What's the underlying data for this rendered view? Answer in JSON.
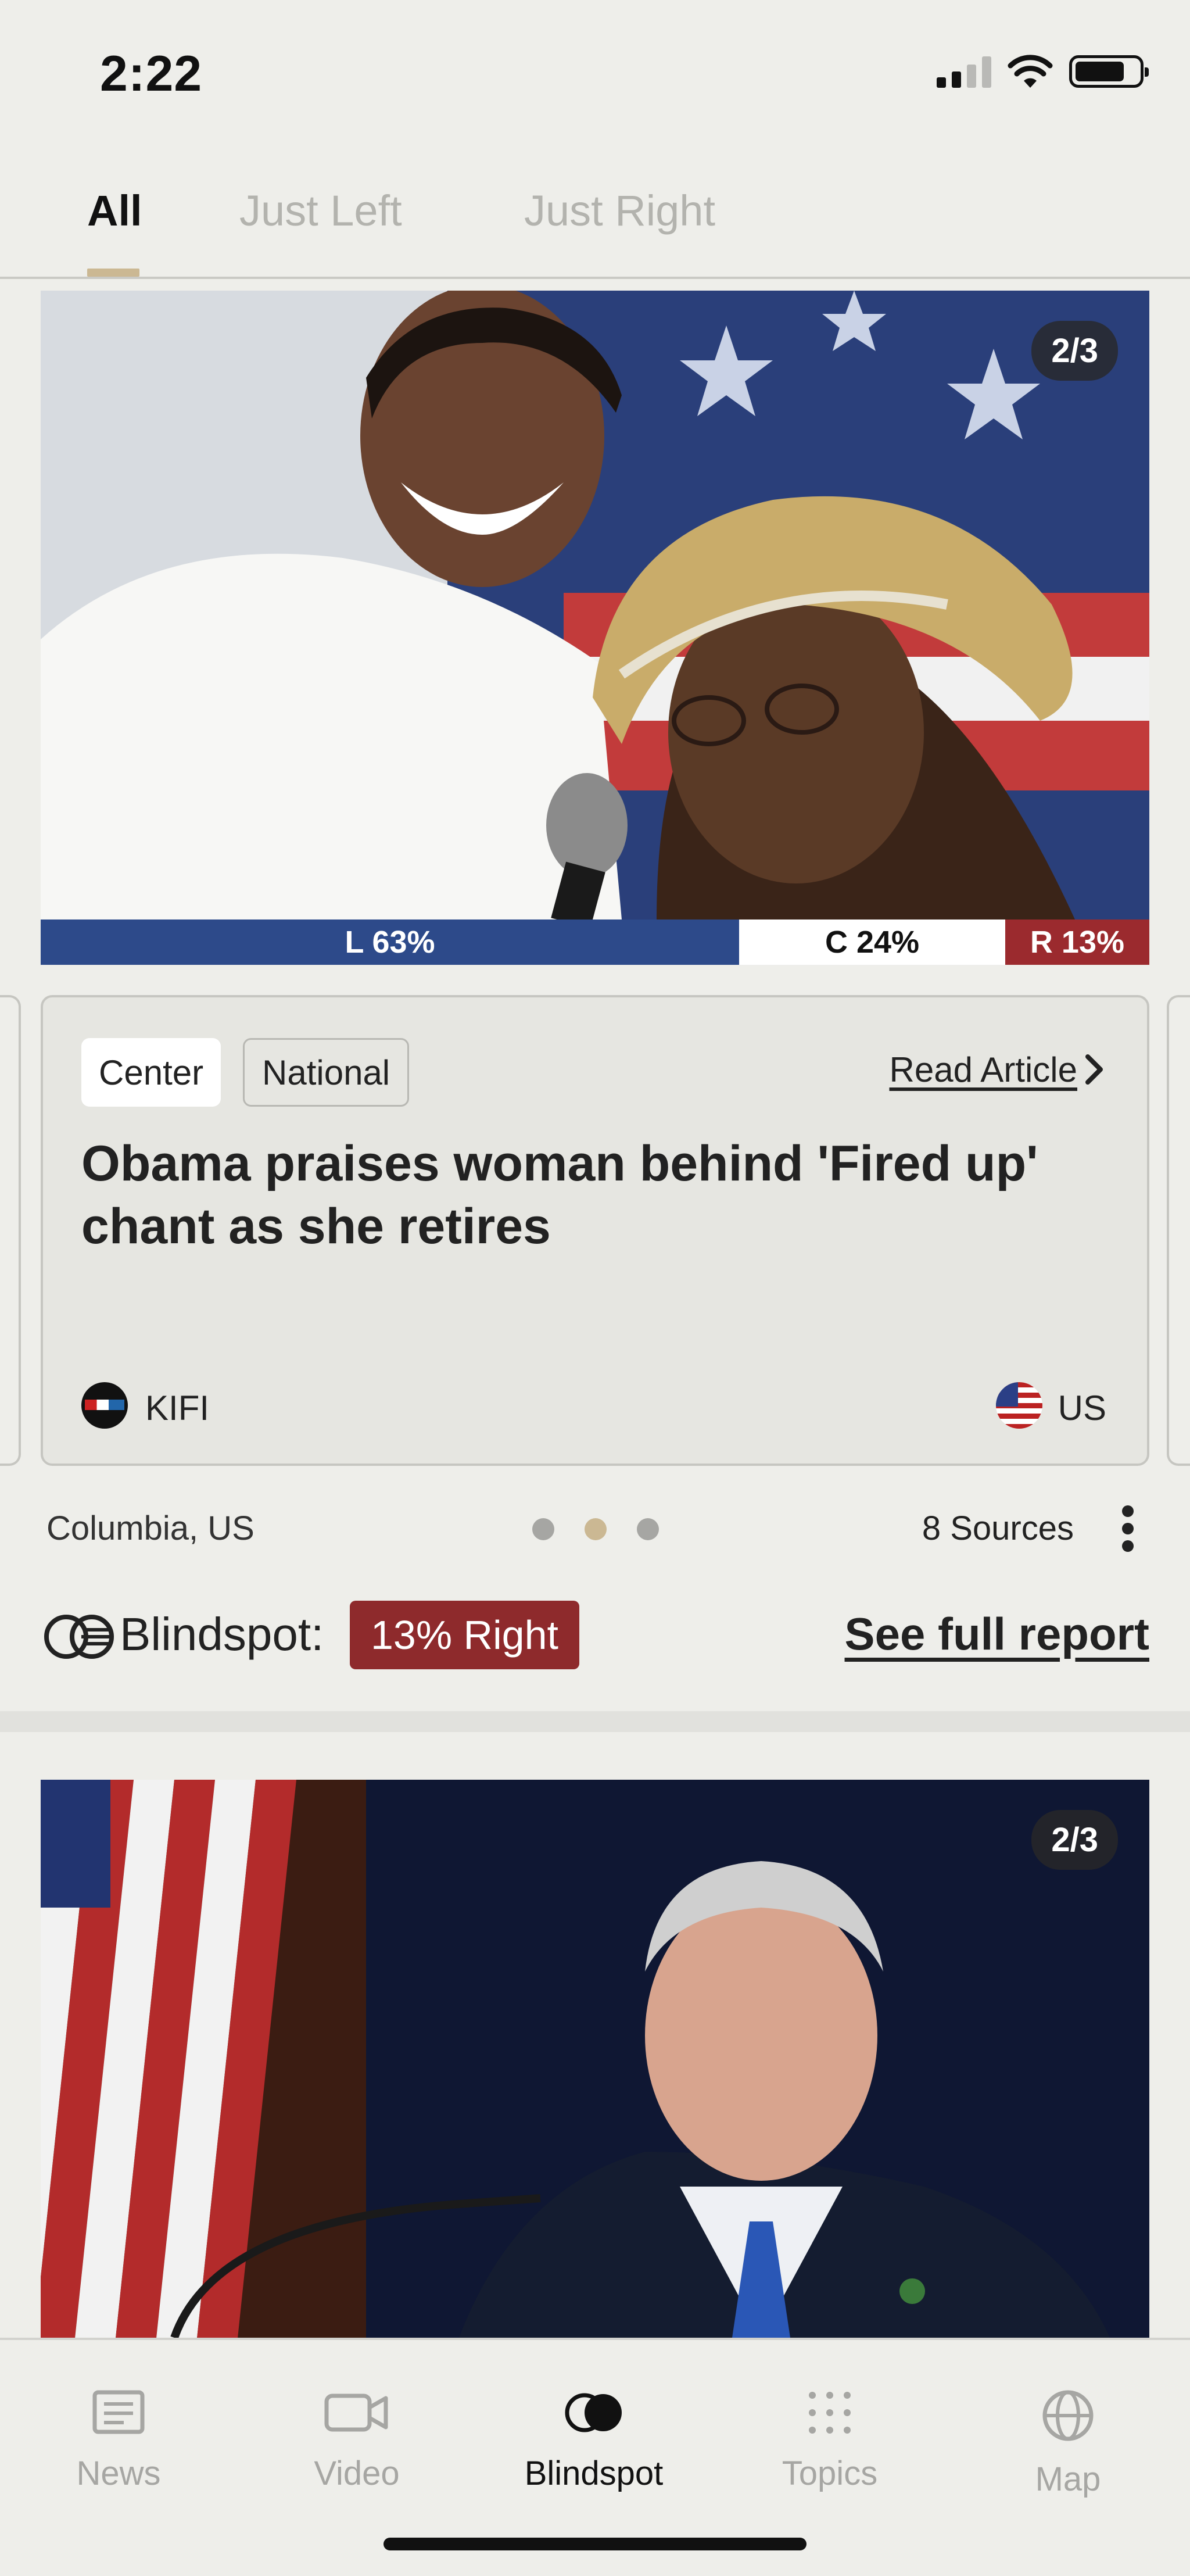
{
  "status_bar": {
    "time": "2:22"
  },
  "tabs": [
    {
      "label": "All",
      "active": true
    },
    {
      "label": "Just Left",
      "active": false
    },
    {
      "label": "Just Right",
      "active": false
    }
  ],
  "story1": {
    "slide_counter": "2/3",
    "bias": {
      "left_label": "L 63%",
      "center_label": "C 24%",
      "right_label": "R 13%",
      "left_pct": 63,
      "center_pct": 24,
      "right_pct": 13
    },
    "tags": [
      "Center",
      "National"
    ],
    "read_article": "Read Article",
    "headline": "Obama praises woman behind 'Fired up' chant as she retires",
    "source_name": "KIFI",
    "country": "US",
    "location": "Columbia, US",
    "pagination": {
      "total": 3,
      "active": 2
    },
    "sources_count": "8 Sources",
    "blindspot_label": "Blindspot:",
    "blindspot_badge": "13% Right",
    "full_report": "See full report"
  },
  "story2": {
    "slide_counter": "2/3"
  },
  "bottom_nav": [
    {
      "label": "News",
      "icon": "news-icon",
      "active": false
    },
    {
      "label": "Video",
      "icon": "video-icon",
      "active": false
    },
    {
      "label": "Blindspot",
      "icon": "blindspot-icon",
      "active": true
    },
    {
      "label": "Topics",
      "icon": "topics-icon",
      "active": false
    },
    {
      "label": "Map",
      "icon": "map-icon",
      "active": false
    }
  ],
  "colors": {
    "background": "#eeeeea",
    "accent": "#cbb893",
    "left": "#2d4a8a",
    "right": "#9b2a2e"
  }
}
